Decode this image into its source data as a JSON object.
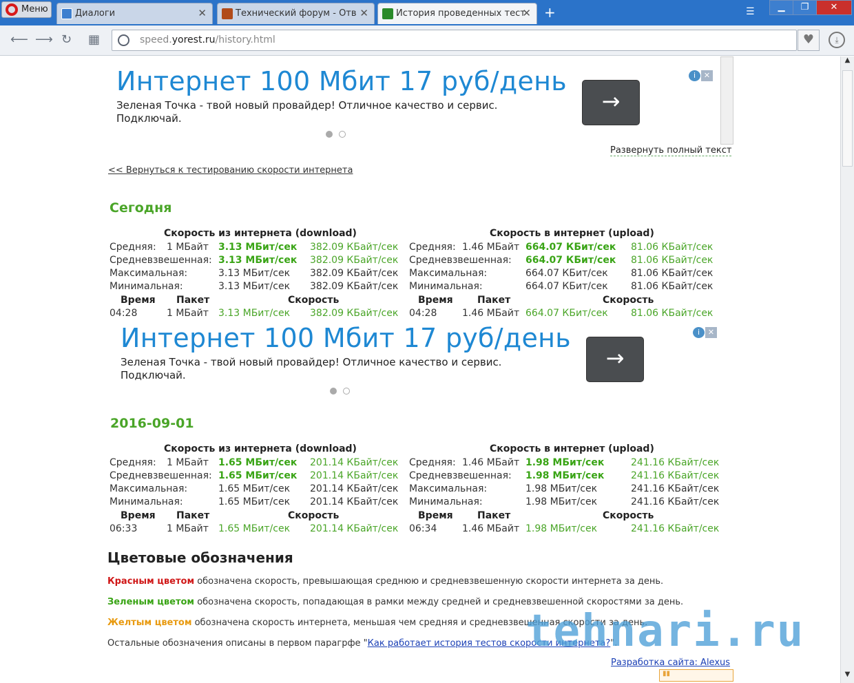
{
  "browser": {
    "menu_label": "Меню",
    "tabs": [
      {
        "title": "Диалоги",
        "close": "✕"
      },
      {
        "title": "Технический форум - Отв",
        "close": "✕"
      },
      {
        "title": "История проведенных тест",
        "close": "✕"
      }
    ],
    "new_tab": "+",
    "url_prefix": "speed.",
    "url_host": "yorest.ru",
    "url_path": "/history.html"
  },
  "ads": [
    {
      "title": "Интернет 100 Мбит 17 руб/день",
      "desc_line1": "Зеленая Точка - твой новый провайдер! Отличное качество и сервис.",
      "desc_line2": "Подключай."
    },
    {
      "title": "Интернет 100 Мбит 17 руб/день",
      "desc_line1": "Зеленая Точка - твой новый провайдер! Отличное качество и сервис.",
      "desc_line2": "Подключай."
    }
  ],
  "expand_label": "Развернуть полный текст",
  "back_link": "<< Вернуться к тестированию скорости интернета",
  "labels": {
    "download": "Скорость из интернета (download)",
    "upload": "Скорость в интернет (upload)",
    "avg": "Средняя:",
    "wavg": "Средневзвешенная:",
    "max": "Максимальная:",
    "min": "Минимальная:",
    "time": "Время",
    "packet": "Пакет",
    "speed": "Скорость"
  },
  "sections": [
    {
      "title": "Сегодня",
      "down": {
        "avg_pkt": "1 МБайт",
        "avg_mbit": "3.13 МБит/сек",
        "avg_kbyte": "382.09 КБайт/сек",
        "wavg_mbit": "3.13 МБит/сек",
        "wavg_kbyte": "382.09 КБайт/сек",
        "max_mbit": "3.13 МБит/сек",
        "max_kbyte": "382.09 КБайт/сек",
        "min_mbit": "3.13 МБит/сек",
        "min_kbyte": "382.09 КБайт/сек",
        "row_time": "04:28",
        "row_pkt": "1 МБайт",
        "row_mbit": "3.13 МБит/сек",
        "row_kbyte": "382.09 КБайт/сек"
      },
      "up": {
        "avg_pkt": "1.46 МБайт",
        "avg_mbit": "664.07 КБит/сек",
        "avg_kbyte": "81.06 КБайт/сек",
        "wavg_mbit": "664.07 КБит/сек",
        "wavg_kbyte": "81.06 КБайт/сек",
        "max_mbit": "664.07 КБит/сек",
        "max_kbyte": "81.06 КБайт/сек",
        "min_mbit": "664.07 КБит/сек",
        "min_kbyte": "81.06 КБайт/сек",
        "row_time": "04:28",
        "row_pkt": "1.46 МБайт",
        "row_mbit": "664.07 КБит/сек",
        "row_kbyte": "81.06 КБайт/сек"
      }
    },
    {
      "title": "2016-09-01",
      "down": {
        "avg_pkt": "1 МБайт",
        "avg_mbit": "1.65 МБит/сек",
        "avg_kbyte": "201.14 КБайт/сек",
        "wavg_mbit": "1.65 МБит/сек",
        "wavg_kbyte": "201.14 КБайт/сек",
        "max_mbit": "1.65 МБит/сек",
        "max_kbyte": "201.14 КБайт/сек",
        "min_mbit": "1.65 МБит/сек",
        "min_kbyte": "201.14 КБайт/сек",
        "row_time": "06:33",
        "row_pkt": "1 МБайт",
        "row_mbit": "1.65 МБит/сек",
        "row_kbyte": "201.14 КБайт/сек"
      },
      "up": {
        "avg_pkt": "1.46 МБайт",
        "avg_mbit": "1.98 МБит/сек",
        "avg_kbyte": "241.16 КБайт/сек",
        "wavg_mbit": "1.98 МБит/сек",
        "wavg_kbyte": "241.16 КБайт/сек",
        "max_mbit": "1.98 МБит/сек",
        "max_kbyte": "241.16 КБайт/сек",
        "min_mbit": "1.98 МБит/сек",
        "min_kbyte": "241.16 КБайт/сек",
        "row_time": "06:34",
        "row_pkt": "1.46 МБайт",
        "row_mbit": "1.98 МБит/сек",
        "row_kbyte": "241.16 КБайт/сек"
      }
    }
  ],
  "legend": {
    "title": "Цветовые обозначения",
    "red_key": "Красным цветом",
    "red_text": " обозначена скорость, превышающая среднюю и средневзвешенную скорости интернета за день.",
    "green_key": "Зеленым цветом",
    "green_text": " обозначена скорость, попадающая в рамки между средней и средневзвешенной скоростями за день.",
    "yellow_key": "Желтым цветом",
    "yellow_text": " обозначена скорость интернета, меньшая чем средняя и средневзвешенная скорости за день.",
    "other_text": "Остальные обозначения описаны в первом парагрфе \"",
    "other_link": "Как работает история тестов скорости интернета?",
    "other_end": "\"."
  },
  "dev_link": "Разработка сайта: Alexus",
  "watermark": "tehnari.ru",
  "colors": {
    "accent_green": "#39a415",
    "ad_blue": "#1e88d3",
    "red": "#d01818",
    "yellow": "#e89a10"
  }
}
